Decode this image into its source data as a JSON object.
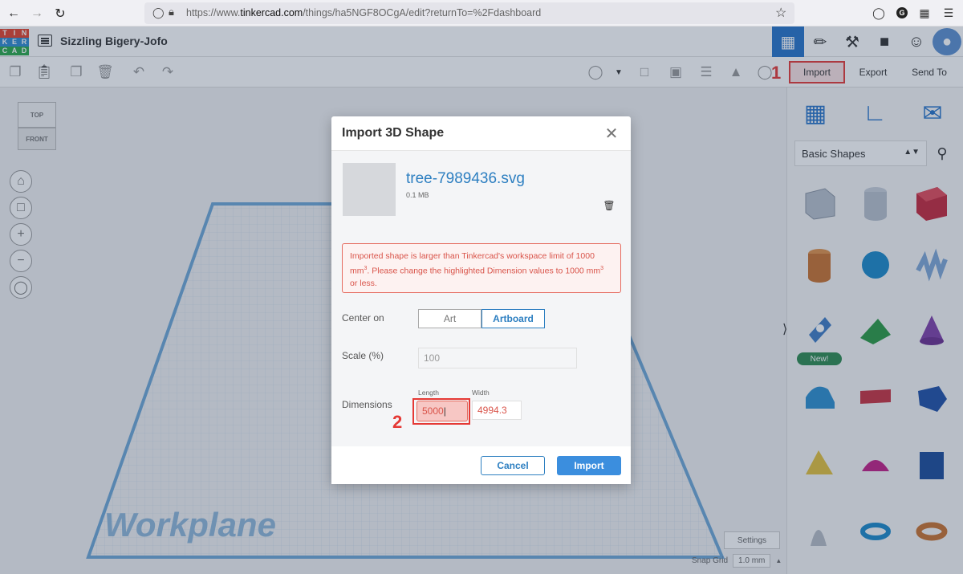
{
  "browser": {
    "url_prefix": "https://www.",
    "url_domain": "tinkercad.com",
    "url_path": "/things/ha5NGF8OCgA/edit?returnTo=%2Fdashboard",
    "back_icon": "arrow-left-icon",
    "forward_icon": "arrow-right-icon",
    "reload_icon": "reload-icon"
  },
  "app": {
    "logo_letters": [
      "T",
      "I",
      "N",
      "K",
      "E",
      "R",
      "C",
      "A",
      "D"
    ],
    "logo_colors": [
      "#e2412b",
      "#e2412b",
      "#e2412b",
      "#2f8ad0",
      "#2f8ad0",
      "#2f8ad0",
      "#2aa84a",
      "#2aa84a",
      "#2aa84a"
    ],
    "design_title": "Sizzling Bigery-Jofo"
  },
  "toolbar": {
    "import_label": "Import",
    "export_label": "Export",
    "send_to_label": "Send To",
    "step1": "1",
    "step2": "2"
  },
  "viewcube": {
    "top": "TOP",
    "front": "FRONT"
  },
  "workspace": {
    "workplane_label": "Workplane",
    "settings_label": "Settings",
    "snap_grid_label": "Snap Grid",
    "snap_grid_value": "1.0 mm"
  },
  "panel": {
    "category": "Basic Shapes",
    "new_badge": "New!"
  },
  "modal": {
    "title": "Import 3D Shape",
    "filename": "tree-7989436.svg",
    "filesize": "0.1 MB",
    "error_part1": "Imported shape is larger than Tinkercad's workspace limit of 1000 mm",
    "error_part2": ". Please change the highlighted Dimension values to 1000 mm",
    "error_part3": " or less.",
    "error_sup": "3",
    "center_on_label": "Center on",
    "center_art": "Art",
    "center_artboard": "Artboard",
    "scale_label": "Scale (%)",
    "scale_value": "100",
    "dimensions_label": "Dimensions",
    "length_label": "Length",
    "length_value": "5000",
    "width_label": "Width",
    "width_value": "4994.3",
    "cancel_label": "Cancel",
    "import_label": "Import"
  }
}
